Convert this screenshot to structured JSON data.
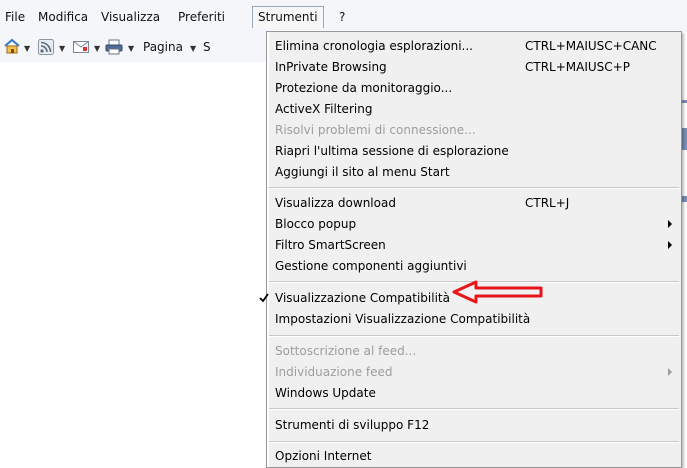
{
  "menubar": {
    "items": [
      "File",
      "Modifica",
      "Visualizza",
      "Preferiti",
      "Strumenti",
      "?"
    ]
  },
  "commandbar": {
    "home_icon": "home-icon",
    "feeds_icon": "rss-feed-icon",
    "mail_icon": "mail-icon",
    "print_icon": "print-icon",
    "page_label": "Pagina",
    "partial_label": "S"
  },
  "menu": {
    "items": [
      {
        "label": "Elimina cronologia esplorazioni...",
        "shortcut": "CTRL+MAIUSC+CANC"
      },
      {
        "label": "InPrivate Browsing",
        "shortcut": "CTRL+MAIUSC+P"
      },
      {
        "label": "Protezione da monitoraggio...",
        "shortcut": ""
      },
      {
        "label": "ActiveX Filtering",
        "shortcut": ""
      },
      {
        "label": "Risolvi problemi di connessione...",
        "shortcut": "",
        "disabled": true
      },
      {
        "label": "Riapri l'ultima sessione di esplorazione",
        "shortcut": ""
      },
      {
        "label": "Aggiungi il sito al menu Start",
        "shortcut": ""
      },
      {
        "label": "Visualizza download",
        "shortcut": "CTRL+J"
      },
      {
        "label": "Blocco popup",
        "shortcut": "",
        "submenu": true
      },
      {
        "label": "Filtro SmartScreen",
        "shortcut": "",
        "submenu": true
      },
      {
        "label": "Gestione componenti aggiuntivi",
        "shortcut": ""
      },
      {
        "label": "Visualizzazione Compatibilità",
        "shortcut": "",
        "checked": true
      },
      {
        "label": "Impostazioni Visualizzazione Compatibilità",
        "shortcut": ""
      },
      {
        "label": "Sottoscrizione al feed...",
        "shortcut": "",
        "disabled": true
      },
      {
        "label": "Individuazione feed",
        "shortcut": "",
        "disabled": true,
        "submenu": true
      },
      {
        "label": "Windows Update",
        "shortcut": ""
      },
      {
        "label": "Strumenti di sviluppo F12",
        "shortcut": ""
      },
      {
        "label": "Opzioni Internet",
        "shortcut": ""
      }
    ]
  },
  "annotation": {
    "type": "red-arrow",
    "color": "#e8141a"
  },
  "colors": {
    "menu_bg": "#f0f0f0",
    "disabled_text": "#9d9d9d",
    "menubar_bg": "#f4f6f9"
  }
}
